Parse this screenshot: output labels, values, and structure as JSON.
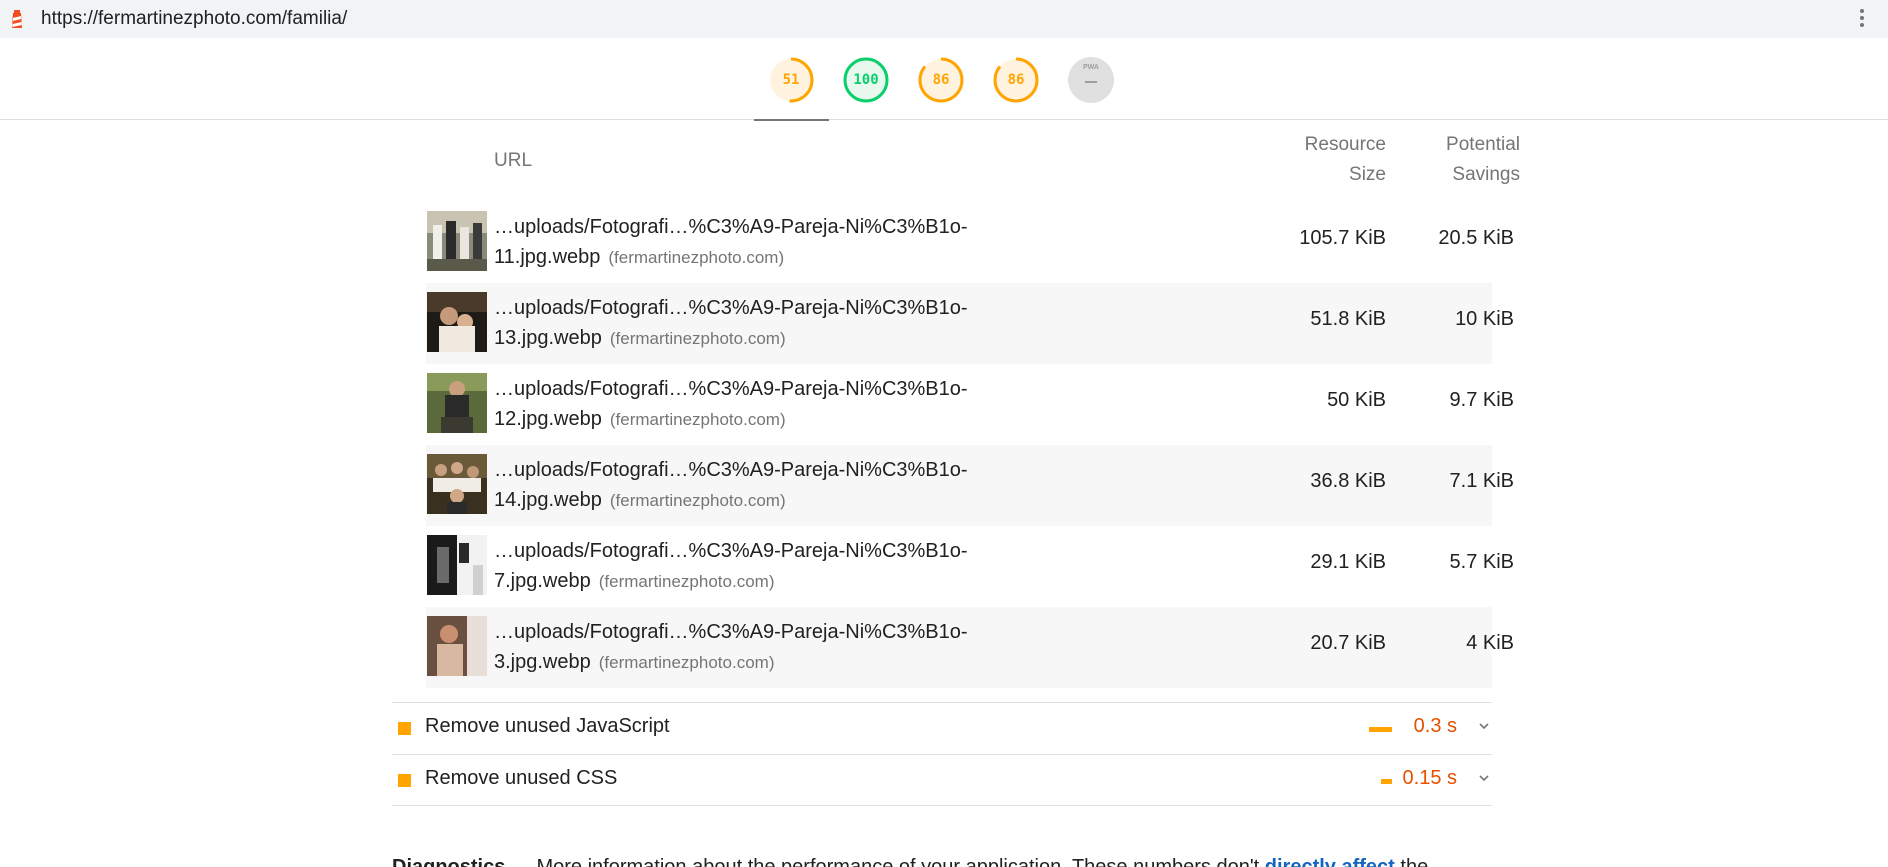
{
  "top_bar": {
    "url": "https://fermartinezphoto.com/familia/",
    "logo_icon": "lighthouse-icon",
    "menu_icon": "kebab-menu-icon"
  },
  "gauges": [
    {
      "label": "51",
      "score": 51,
      "color": "#ffa400",
      "active": true
    },
    {
      "label": "100",
      "score": 100,
      "color": "#0cce6b",
      "active": false
    },
    {
      "label": "86",
      "score": 86,
      "color": "#ffa400",
      "active": false
    },
    {
      "label": "86",
      "score": 86,
      "color": "#ffa400",
      "active": false
    },
    {
      "label": "PWA",
      "score": null,
      "color": "#e0e0e0",
      "active": false
    }
  ],
  "table": {
    "headers": {
      "url": "URL",
      "size_line1": "Resource",
      "size_line2": "Size",
      "savings_line1": "Potential",
      "savings_line2": "Savings"
    },
    "rows": [
      {
        "path_line1": "…uploads/Fotografi…%C3%A9-Pareja-Ni%C3%B1o-",
        "path_line2": "11.jpg.webp",
        "host": "(fermartinezphoto.com)",
        "size": "105.7 KiB",
        "savings": "20.5 KiB"
      },
      {
        "path_line1": "…uploads/Fotografi…%C3%A9-Pareja-Ni%C3%B1o-",
        "path_line2": "13.jpg.webp",
        "host": "(fermartinezphoto.com)",
        "size": "51.8 KiB",
        "savings": "10 KiB"
      },
      {
        "path_line1": "…uploads/Fotografi…%C3%A9-Pareja-Ni%C3%B1o-",
        "path_line2": "12.jpg.webp",
        "host": "(fermartinezphoto.com)",
        "size": "50 KiB",
        "savings": "9.7 KiB"
      },
      {
        "path_line1": "…uploads/Fotografi…%C3%A9-Pareja-Ni%C3%B1o-",
        "path_line2": "14.jpg.webp",
        "host": "(fermartinezphoto.com)",
        "size": "36.8 KiB",
        "savings": "7.1 KiB"
      },
      {
        "path_line1": "…uploads/Fotografi…%C3%A9-Pareja-Ni%C3%B1o-",
        "path_line2": "7.jpg.webp",
        "host": "(fermartinezphoto.com)",
        "size": "29.1 KiB",
        "savings": "5.7 KiB"
      },
      {
        "path_line1": "…uploads/Fotografi…%C3%A9-Pareja-Ni%C3%B1o-",
        "path_line2": "3.jpg.webp",
        "host": "(fermartinezphoto.com)",
        "size": "20.7 KiB",
        "savings": "4 KiB"
      }
    ]
  },
  "audits": [
    {
      "title": "Remove unused JavaScript",
      "value": "0.3 s"
    },
    {
      "title": "Remove unused CSS",
      "value": "0.15 s"
    }
  ],
  "diagnostics": {
    "heading": "Diagnostics",
    "text": " — More information about the performance of your application. These numbers don't ",
    "link": "directly affect",
    "tail": " the"
  }
}
